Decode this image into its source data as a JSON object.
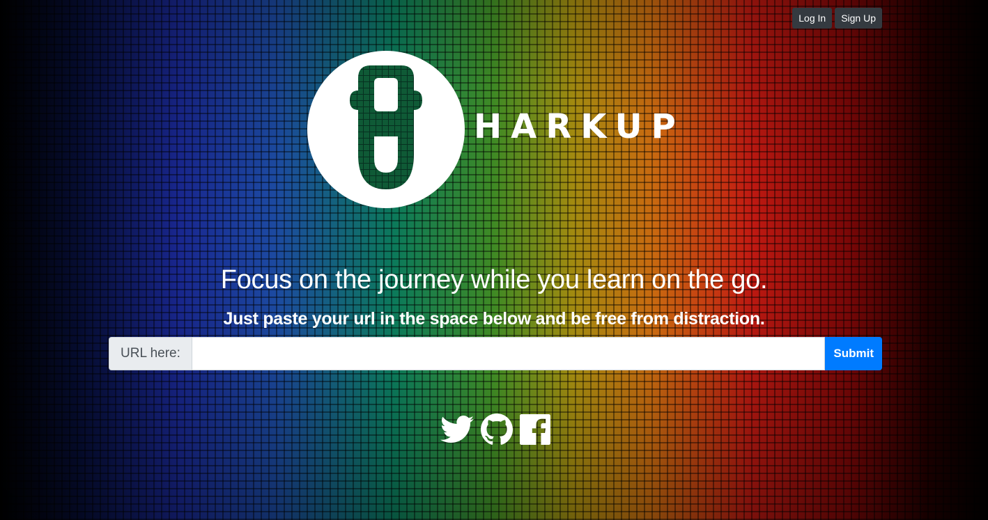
{
  "nav": {
    "login_label": "Log In",
    "signup_label": "Sign Up"
  },
  "logo": {
    "wordmark": "HARKUP"
  },
  "hero": {
    "headline": "Focus on the journey while you learn on the go.",
    "subline": "Just paste your url in the space below and be free from distraction."
  },
  "url_form": {
    "label": "URL here:",
    "value": "",
    "submit_label": "Submit"
  },
  "social": {
    "icons": [
      "twitter-icon",
      "github-icon",
      "facebook-icon"
    ]
  },
  "colors": {
    "submit_blue": "#007bff",
    "nav_button_dark": "#343a40",
    "logo_green": "#0f5a36"
  }
}
